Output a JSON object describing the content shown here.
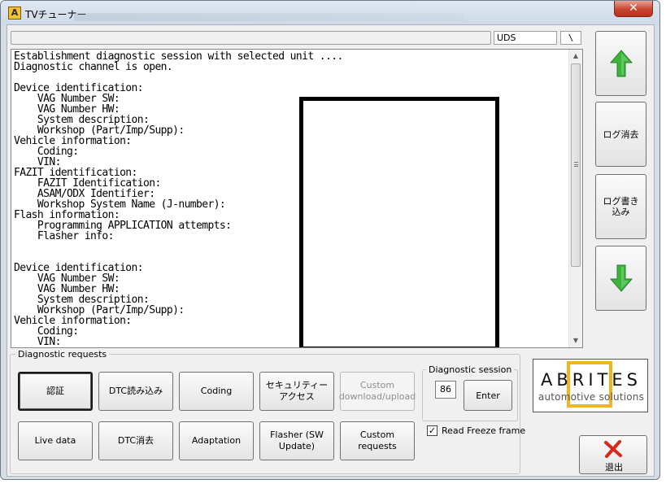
{
  "window": {
    "title": "TVチューナー",
    "app_icon_letter": "A",
    "close_glyph": "✕"
  },
  "status": {
    "main_text": "",
    "protocol": "UDS",
    "spinner": "\\"
  },
  "log": {
    "lines": [
      "Establishment diagnostic session with selected unit ....",
      "Diagnostic channel is open.",
      "",
      "Device identification:",
      "    VAG Number SW:",
      "    VAG Number HW:",
      "    System description:",
      "    Workshop (Part/Imp/Supp):",
      "Vehicle information:",
      "    Coding:",
      "    VIN:",
      "FAZIT identification:",
      "    FAZIT Identification:",
      "    ASAM/ODX Identifier:",
      "    Workshop System Name (J-number):",
      "Flash information:",
      "    Programming APPLICATION attempts:",
      "    Flasher info:",
      "",
      "",
      "Device identification:",
      "    VAG Number SW:",
      "    VAG Number HW:",
      "    System description:",
      "    Workshop (Part/Imp/Supp):",
      "Vehicle information:",
      "    Coding:",
      "    VIN:"
    ]
  },
  "side": {
    "up_icon": "arrow-up-icon",
    "clear_log": "ログ消去",
    "write_log": "ログ書き込み",
    "down_icon": "arrow-down-icon"
  },
  "requests": {
    "group_label": "Diagnostic requests",
    "buttons": {
      "auth": "認証",
      "dtc_read": "DTC読み込み",
      "coding": "Coding",
      "security": "セキュリティーアクセス",
      "custom_transfer": "Custom download/upload",
      "live_data": "Live data",
      "dtc_clear": "DTC消去",
      "adaptation": "Adaptation",
      "flasher": "Flasher (SW Update)",
      "custom_requests": "Custom requests"
    }
  },
  "session": {
    "label": "Diagnostic session",
    "value": "86",
    "enter": "Enter"
  },
  "freeze": {
    "label": "Read Freeze frame",
    "checked": true,
    "mark": "✓"
  },
  "logo": {
    "top": "ABRITES",
    "bottom": "automotive solutions",
    "accent_color": "#f2b41c"
  },
  "exit": {
    "label": "退出",
    "icon": "red-x-icon"
  },
  "colors": {
    "arrow_green": "#3cb43c",
    "exit_red": "#d8281c"
  }
}
